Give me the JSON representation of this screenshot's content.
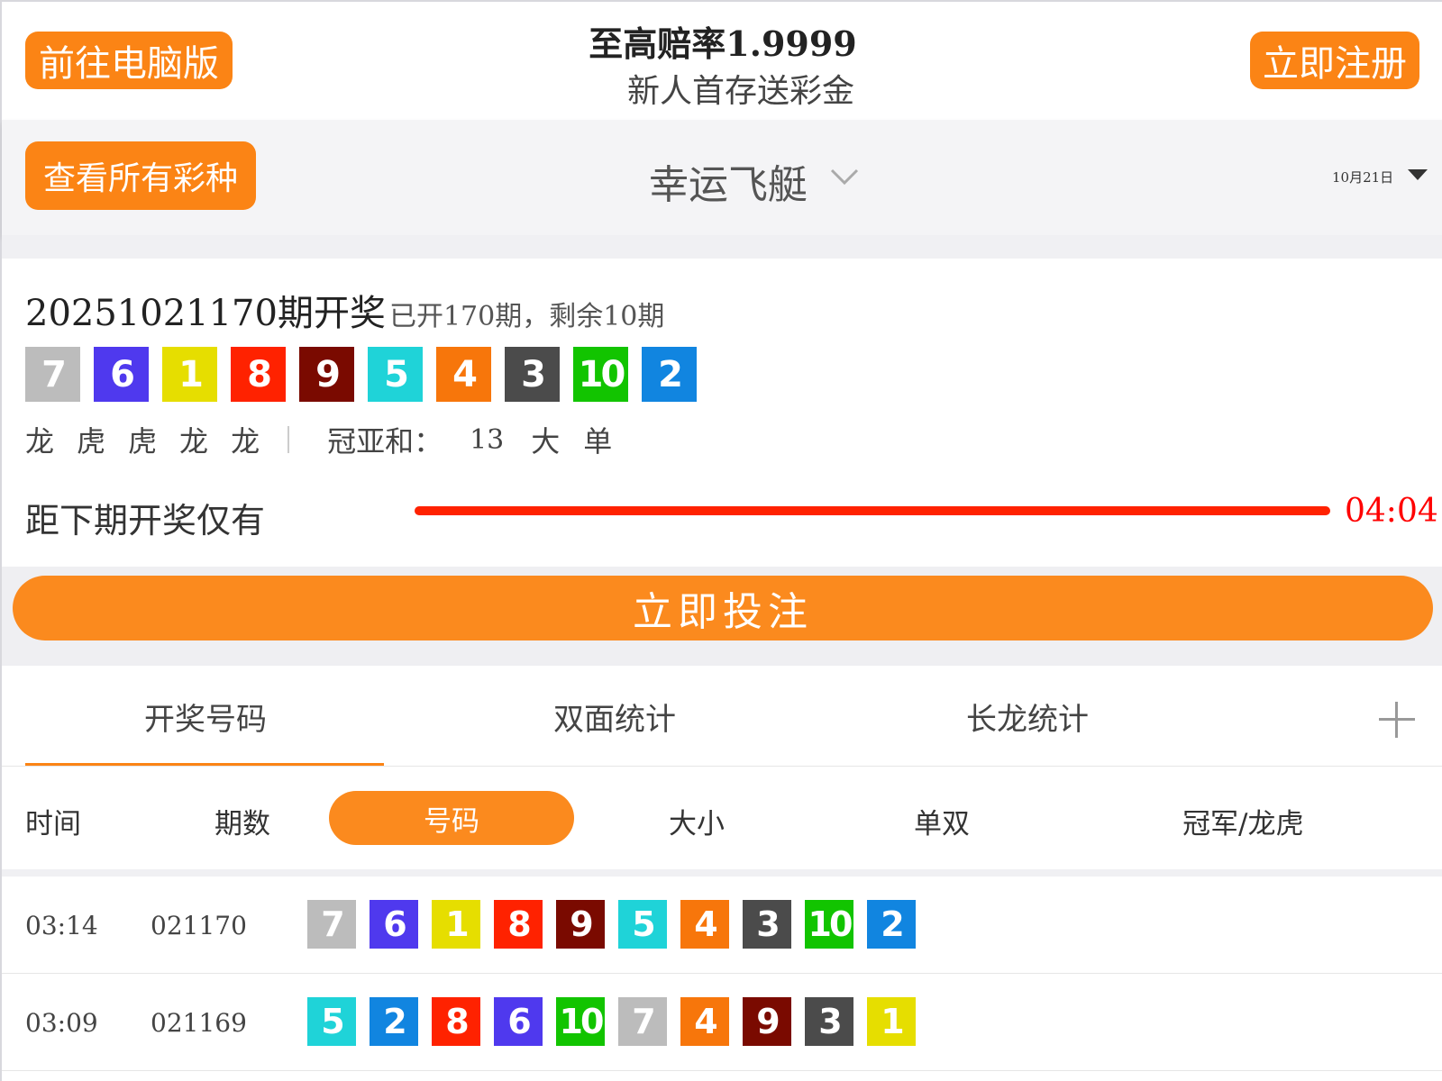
{
  "header": {
    "desktop_label": "前往电脑版",
    "promo_title": "至高赔率1.9999",
    "promo_subtitle": "新人首存送彩金",
    "register_label": "立即注册"
  },
  "selector": {
    "all_lottery_label": "查看所有彩种",
    "lottery_name": "幸运飞艇",
    "date": "10月21日"
  },
  "draw": {
    "issue_title": "20251021170期开奖",
    "issue_sub": "已开170期，剩余10期",
    "numbers": [
      7,
      6,
      1,
      8,
      9,
      5,
      4,
      3,
      10,
      2
    ],
    "dragon_tiger": [
      "龙",
      "虎",
      "虎",
      "龙",
      "龙"
    ],
    "sum_label": "冠亚和：",
    "sum_value": "13",
    "big_small": "大",
    "odd_even": "单",
    "countdown_label": "距下期开奖仅有",
    "countdown_time": "04:04",
    "countdown_progress": 1.0
  },
  "bet_label": "立即投注",
  "tabs": [
    "开奖号码",
    "双面统计",
    "长龙统计"
  ],
  "subtabs": [
    "时间",
    "期数",
    "号码",
    "大小",
    "单双",
    "冠军/龙虎"
  ],
  "rows": [
    {
      "time": "03:14",
      "issue": "021170",
      "numbers": [
        7,
        6,
        1,
        8,
        9,
        5,
        4,
        3,
        10,
        2
      ]
    },
    {
      "time": "03:09",
      "issue": "021169",
      "numbers": [
        5,
        2,
        8,
        6,
        10,
        7,
        4,
        9,
        3,
        1
      ]
    }
  ],
  "ball_colors": {
    "1": "#e6de00",
    "2": "#1185e0",
    "3": "#4b4b4b",
    "4": "#f7760b",
    "5": "#1fd3d8",
    "6": "#4f39ee",
    "7": "#bcbcbc",
    "8": "#ff2200",
    "9": "#7a0a00",
    "10": "#12c400"
  }
}
